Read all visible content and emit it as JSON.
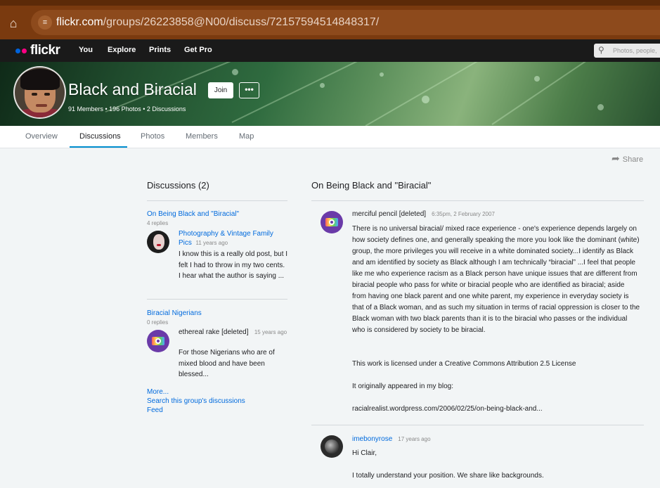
{
  "browser": {
    "url_host": "flickr.com",
    "url_path": "/groups/26223858@N00/discuss/72157594514848317/"
  },
  "nav": {
    "logo": "flickr",
    "items": [
      "You",
      "Explore",
      "Prints",
      "Get Pro"
    ],
    "search_placeholder": "Photos, people,"
  },
  "group": {
    "title": "Black and Biracial",
    "stats": "91 Members • 196 Photos • 2 Discussions",
    "join_label": "Join",
    "more_label": "•••"
  },
  "tabs": [
    {
      "label": "Overview",
      "active": false
    },
    {
      "label": "Discussions",
      "active": true
    },
    {
      "label": "Photos",
      "active": false
    },
    {
      "label": "Members",
      "active": false
    },
    {
      "label": "Map",
      "active": false
    }
  ],
  "share_label": "Share",
  "sidebar": {
    "heading": "Discussions (2)",
    "threads": [
      {
        "title": "On Being Black and \"Biracial\"",
        "replies": "4 replies",
        "poster_name": "Photography & Vintage Family Pics",
        "poster_time": "11 years ago",
        "excerpt": "I know this is a really old post, but I felt I had to throw in my two cents. I hear what the author is saying ..."
      },
      {
        "title": "Biracial Nigerians",
        "replies": "0 replies",
        "poster_name": "ethereal rake [deleted]",
        "poster_time": "15 years ago",
        "excerpt": "For those Nigerians who are of mixed blood and have been blessed..."
      }
    ],
    "more_link": "More...",
    "search_link": "Search this group's discussions",
    "feed_link": "Feed"
  },
  "topic": {
    "heading": "On Being Black and \"Biracial\"",
    "posts": [
      {
        "author": "merciful pencil [deleted]",
        "time": "6:35pm, 2 February 2007",
        "paragraphs": [
          "There is no universal biracial/ mixed race experience - one's experience depends largely on how society defines one, and generally speaking the more you look like the dominant (white) group, the more privileges you will receive in a white dominated society...I identify as Black and am identified by society as Black although I am technically “biracial” ...I feel that people like me who experience racism as a Black person have unique issues that are different from biracial people who pass for white or biracial people who are identified as biracial; aside from having one black parent and one white parent, my experience in everyday society is that of a Black woman, and as such my situation in terms of racial oppression is closer to the Black woman with two black parents than it is to the biracial who passes or the individual who is considered by society to be biracial.",
          "This work is licensed under a Creative Commons Attribution 2.5 License",
          "It originally appeared in my blog:"
        ],
        "link": "racialrealist.wordpress.com/2006/02/25/on-being-black-and..."
      },
      {
        "author": "imebonyrose",
        "time": "17 years ago",
        "paragraphs": [
          "Hi Clair,",
          "I totally understand your position. We share like backgrounds."
        ]
      }
    ]
  }
}
